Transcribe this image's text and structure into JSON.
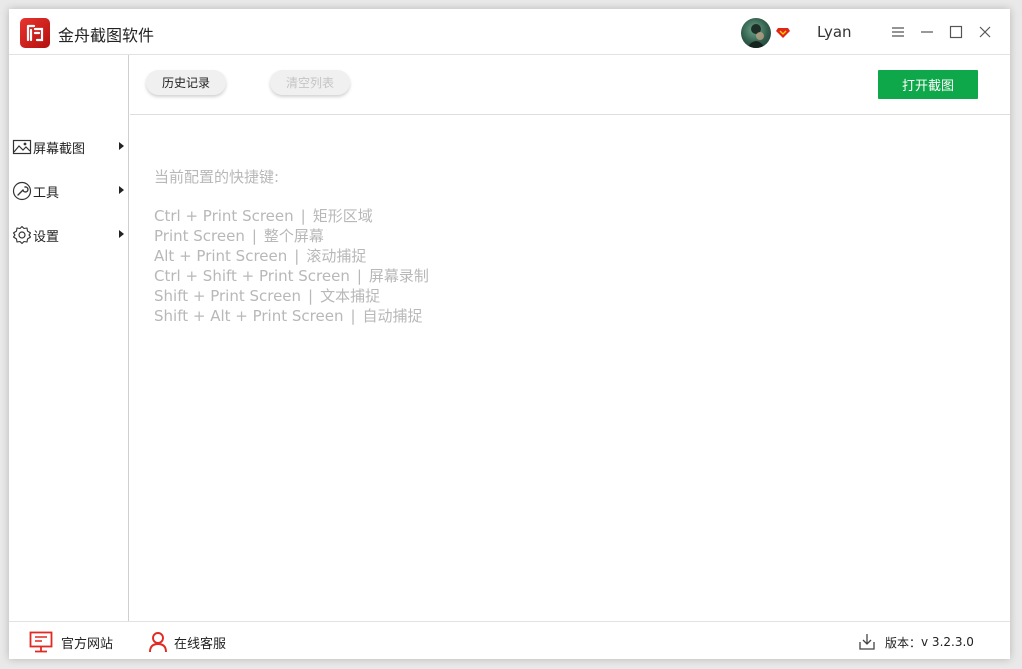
{
  "app": {
    "title": "金舟截图软件"
  },
  "user": {
    "name": "Lyan"
  },
  "sidebar": {
    "items": [
      {
        "label": "屏幕截图",
        "icon": "image-icon"
      },
      {
        "label": "工具",
        "icon": "wrench-icon"
      },
      {
        "label": "设置",
        "icon": "gear-icon"
      }
    ]
  },
  "toolbar": {
    "history_label": "历史记录",
    "clear_label": "清空列表",
    "open_label": "打开截图"
  },
  "content": {
    "hint_title": "当前配置的快捷键:",
    "hotkeys": [
      {
        "keys": "Ctrl + Print Screen",
        "sep": "|",
        "action": "矩形区域"
      },
      {
        "keys": "Print Screen",
        "sep": "|",
        "action": "整个屏幕"
      },
      {
        "keys": "Alt + Print Screen",
        "sep": "|",
        "action": "滚动捕捉"
      },
      {
        "keys": "Ctrl + Shift + Print Screen",
        "sep": "|",
        "action": "屏幕录制"
      },
      {
        "keys": "Shift + Print Screen",
        "sep": "|",
        "action": "文本捕捉"
      },
      {
        "keys": "Shift + Alt + Print Screen",
        "sep": "|",
        "action": "自动捕捉"
      }
    ]
  },
  "statusbar": {
    "website_label": "官方网站",
    "support_label": "在线客服",
    "version_label": "版本：",
    "version_value": "v 3.2.3.0"
  },
  "colors": {
    "accent": "#0ea74a",
    "brand": "#d9261f",
    "hint_text": "#b8b8b8"
  }
}
